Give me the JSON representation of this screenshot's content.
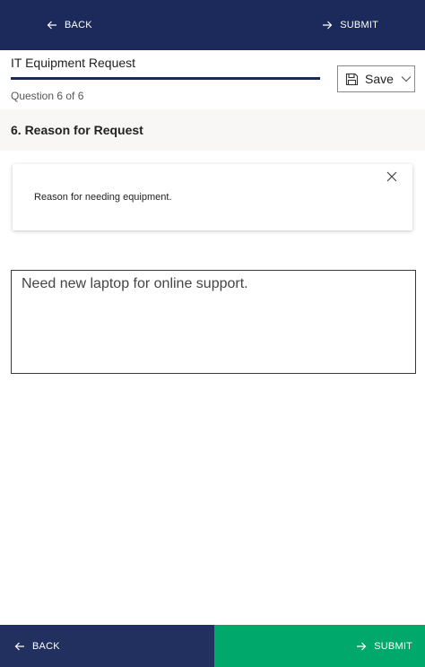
{
  "top_nav": {
    "back_label": "BACK",
    "submit_label": "SUBMIT"
  },
  "header": {
    "form_title": "IT Equipment Request",
    "question_counter": "Question 6 of 6",
    "progress": 1.0,
    "save_label": "Save"
  },
  "question": {
    "title": "6. Reason for Request",
    "help_text": "Reason for needing equipment.",
    "answer_value": "Need new laptop for online support."
  },
  "bottom_nav": {
    "back_label": "BACK",
    "submit_label": "SUBMIT"
  },
  "colors": {
    "nav_dark": "#1b2a5b",
    "bottom_back": "#22305f",
    "submit_green": "#00a86b"
  },
  "icons": {
    "back": "arrow-left-icon",
    "submit": "arrow-right-icon",
    "save": "floppy-disk-icon",
    "dropdown": "chevron-down-icon",
    "close": "close-icon"
  }
}
